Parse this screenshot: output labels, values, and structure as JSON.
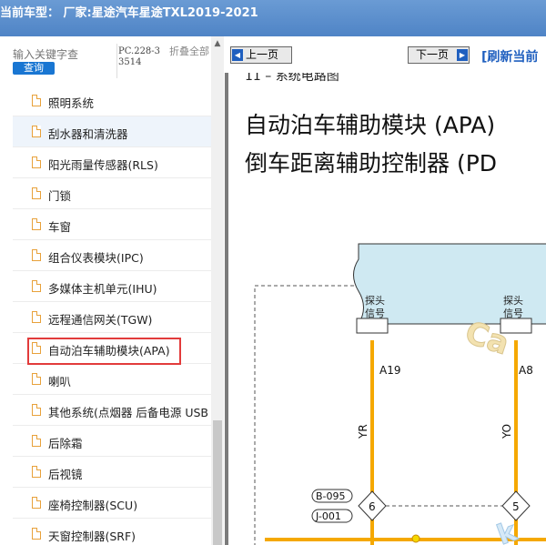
{
  "titlebar": {
    "text": "当前车型： 厂家:星途汽车星途TXL2019-2021"
  },
  "sidebar": {
    "search_placeholder": "输入关键字查",
    "search_button": "查询",
    "pc_code": "PC.228-33514",
    "collapse_all": "折叠全部",
    "items": [
      {
        "label": "照明系统"
      },
      {
        "label": "刮水器和清洗器"
      },
      {
        "label": "阳光雨量传感器(RLS)"
      },
      {
        "label": "门锁"
      },
      {
        "label": "车窗"
      },
      {
        "label": "组合仪表模块(IPC)"
      },
      {
        "label": "多媒体主机单元(IHU)"
      },
      {
        "label": "远程通信网关(TGW)"
      },
      {
        "label": "自动泊车辅助模块(APA)"
      },
      {
        "label": "喇叭"
      },
      {
        "label": "其他系统(点烟器 后备电源 USB"
      },
      {
        "label": "后除霜"
      },
      {
        "label": "后视镜"
      },
      {
        "label": "座椅控制器(SCU)"
      },
      {
        "label": "天窗控制器(SRF)"
      }
    ]
  },
  "viewer": {
    "prev_page": "上一页",
    "next_page": "下一页",
    "refresh": "[刷新当前",
    "section_header": "11 – 系统电路图",
    "title_line1": "自动泊车辅助模块 (APA)",
    "title_line2": "倒车距离辅助控制器 (PD",
    "diagram": {
      "left_label_line1": "探头",
      "left_label_line2": "信号",
      "left_pin": "A19",
      "right_label_line1": "探头",
      "right_label_line2": "信号",
      "right_pin": "A8",
      "left_wire_color": "YR",
      "right_wire_color": "YO",
      "connector_1": "B-095",
      "connector_2": "J-001",
      "splice_left": "6",
      "splice_right": "5",
      "watermark_1": "Ca",
      "watermark_2": "k"
    },
    "colors": {
      "module_fill": "#cfe9f2",
      "wire": "#f5a800",
      "wire_dark": "#c98a00"
    }
  }
}
